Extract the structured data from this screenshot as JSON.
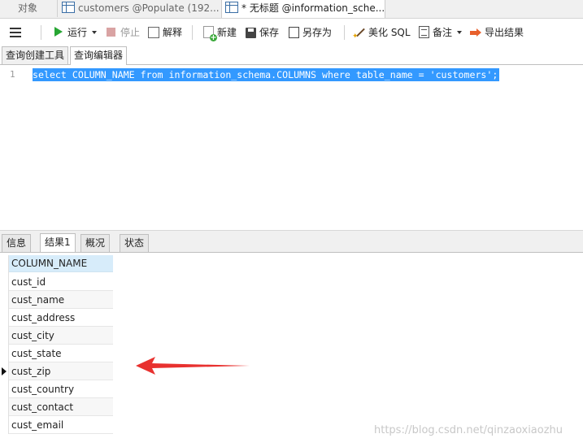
{
  "tabs": [
    {
      "label": "对象",
      "active": false
    },
    {
      "label": "customers @Populate (192...",
      "active": false
    },
    {
      "label": "* 无标题 @information_sche...",
      "active": true
    }
  ],
  "toolbar": {
    "run": "运行",
    "stop": "停止",
    "explain": "解释",
    "new": "新建",
    "save": "保存",
    "save_as": "另存为",
    "beautify": "美化 SQL",
    "note": "备注",
    "export": "导出结果"
  },
  "editor_tabs": [
    "查询创建工具",
    "查询编辑器"
  ],
  "editor": {
    "line_number": "1",
    "code": "select COLUMN_NAME from information_schema.COLUMNS where table_name = 'customers';"
  },
  "result_tabs": [
    "信息",
    "结果1",
    "概况",
    "状态"
  ],
  "results": {
    "column": "COLUMN_NAME",
    "rows": [
      "cust_id",
      "cust_name",
      "cust_address",
      "cust_city",
      "cust_state",
      "cust_zip",
      "cust_country",
      "cust_contact",
      "cust_email"
    ]
  },
  "watermark": "https://blog.csdn.net/qinzaoxiaozhu",
  "colors": {
    "selection": "#3399ff",
    "run_icon": "#27a633",
    "arrow": "#e8312f",
    "header": "#d7ecfa"
  }
}
